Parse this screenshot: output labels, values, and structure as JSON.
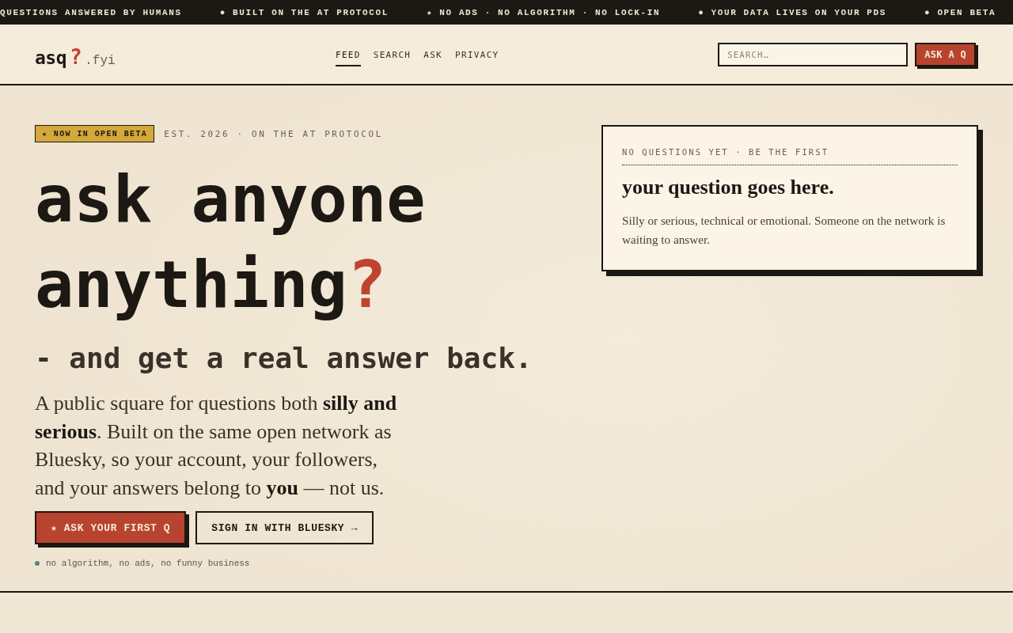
{
  "ticker": [
    "QUESTIONS ANSWERED BY HUMANS",
    "● BUILT ON THE AT PROTOCOL",
    "★ NO ADS · NO ALGORITHM · NO LOCK-IN",
    "● YOUR DATA LIVES ON YOUR PDS",
    "● OPEN BETA"
  ],
  "header": {
    "logo": {
      "wordmark": "asq",
      "mark": "?",
      "domain": ".fyi"
    },
    "nav": [
      {
        "label": "FEED",
        "selected": true
      },
      {
        "label": "SEARCH",
        "selected": false
      },
      {
        "label": "ASK",
        "selected": false
      },
      {
        "label": "PRIVACY",
        "selected": false
      }
    ],
    "search": {
      "placeholder": "SEARCH…"
    },
    "button": "ASK A Q"
  },
  "hero": {
    "badge": "★ NOW IN OPEN BETA",
    "meta": "EST. 2026 · ON THE AT PROTOCOL",
    "headline": {
      "text": "ask anyone anything",
      "mark": "?"
    },
    "subtitle": "- and get a real answer back.",
    "intro": "A public square for questions both **silly and serious**. Built on the same open network as Bluesky, so your account, your followers, and your answers belong to **you** — not us.",
    "actions": [
      {
        "label": "★ ASK YOUR FIRST Q",
        "kind": "primary"
      },
      {
        "label": "SIGN IN WITH BLUESKY →",
        "kind": "secondary"
      }
    ],
    "note": "no algorithm, no ads, no funny business"
  },
  "card": {
    "eyebrow": "NO QUESTIONS YET · BE THE FIRST",
    "title": "your question goes here.",
    "body": "Silly or serious, technical or emotional. Someone on the network is waiting to answer."
  }
}
